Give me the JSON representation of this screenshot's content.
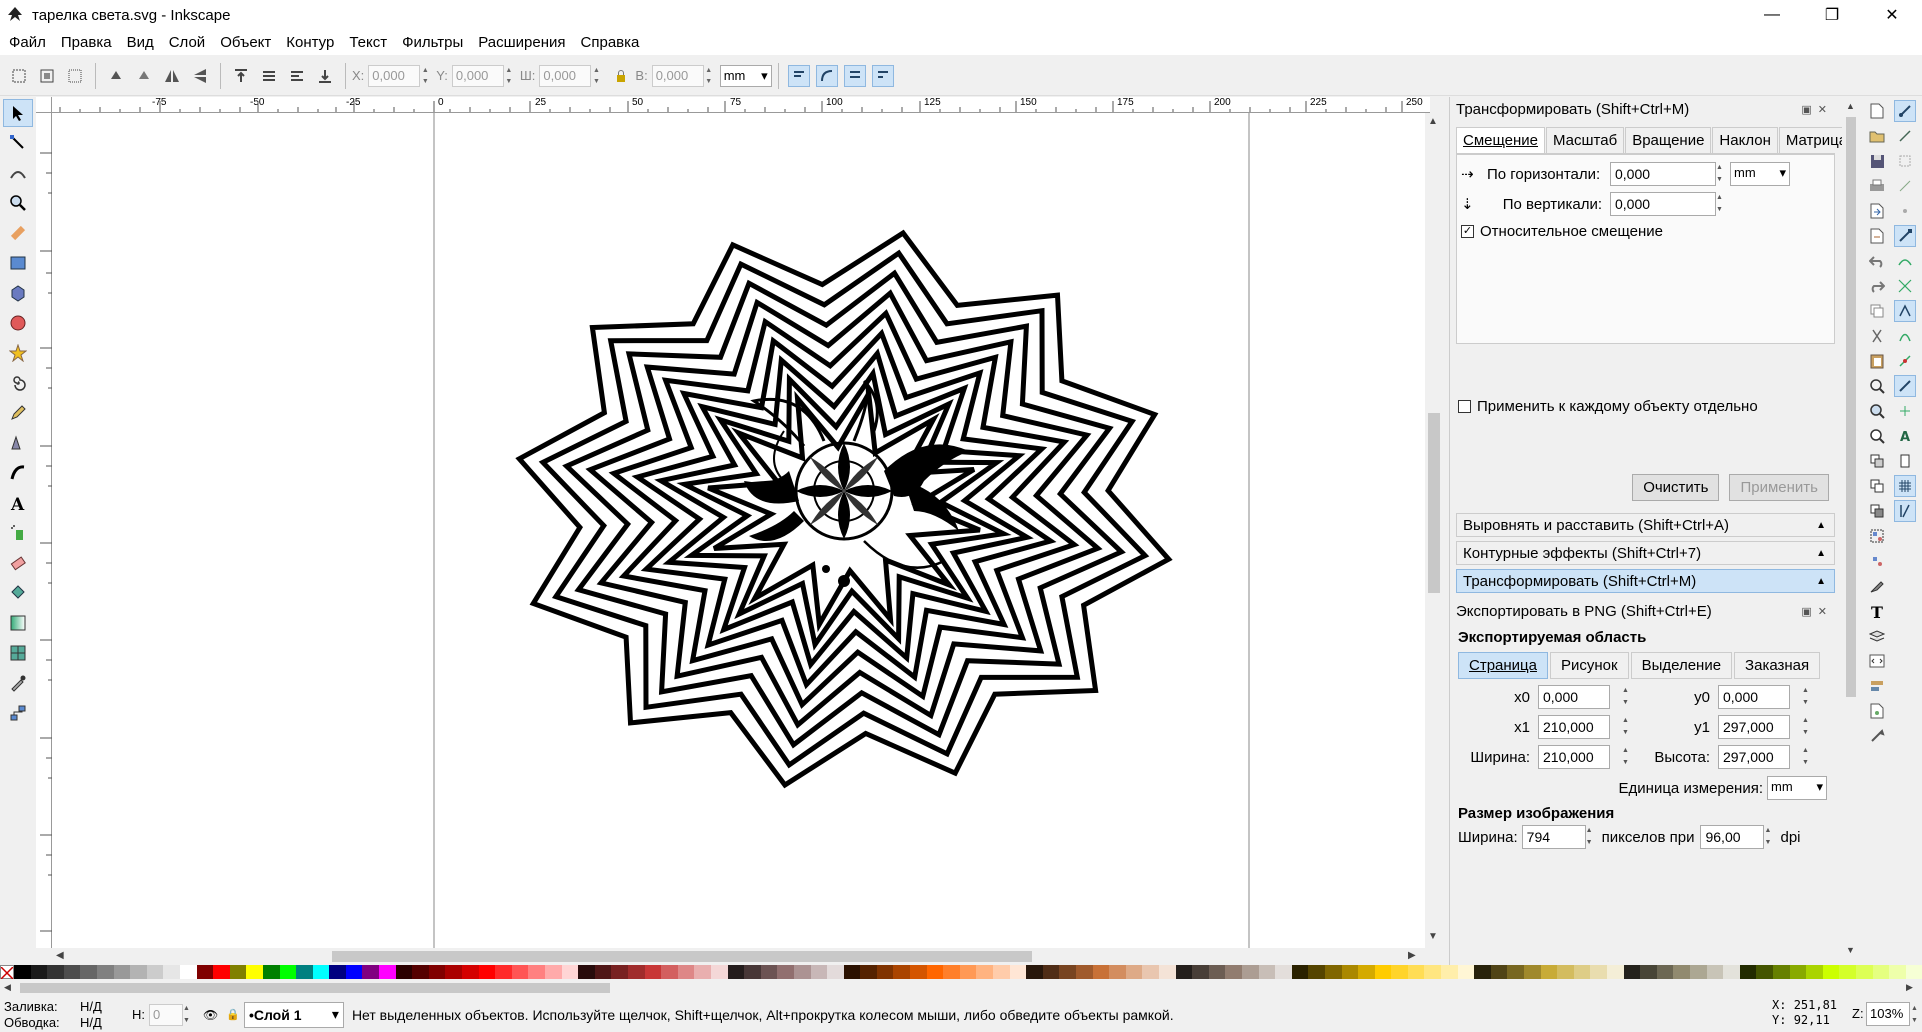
{
  "window": {
    "title": "тарелка света.svg - Inkscape",
    "minimize": "—",
    "maximize": "❐",
    "close": "✕"
  },
  "menu": [
    "Файл",
    "Правка",
    "Вид",
    "Слой",
    "Объект",
    "Контур",
    "Текст",
    "Фильтры",
    "Расширения",
    "Справка"
  ],
  "toolbar": {
    "x_label": "X:",
    "x_value": "0,000",
    "y_label": "Y:",
    "y_value": "0,000",
    "w_label": "Ш:",
    "w_value": "0,000",
    "h_label": "В:",
    "h_value": "0,000",
    "unit": "mm"
  },
  "ruler": {
    "ticks": [
      "-75",
      "-50",
      "-25",
      "0",
      "25",
      "50",
      "75",
      "100",
      "125",
      "150",
      "175",
      "200",
      "225",
      "250"
    ]
  },
  "transform": {
    "header": "Трансформировать (Shift+Ctrl+M)",
    "tabs": [
      "Смещение",
      "Масштаб",
      "Вращение",
      "Наклон",
      "Матрица"
    ],
    "horizontal_label": "По горизонтали:",
    "horizontal_value": "0,000",
    "vertical_label": "По вертикали:",
    "vertical_value": "0,000",
    "unit": "mm",
    "relative_label": "Относительное смещение",
    "apply_each_label": "Применить к каждому объекту отдельно",
    "clear_button": "Очистить",
    "apply_button": "Применить"
  },
  "collapsed_panels": [
    "Выровнять и расставить (Shift+Ctrl+A)",
    "Контурные эффекты (Shift+Ctrl+7)",
    "Трансформировать (Shift+Ctrl+M)"
  ],
  "export": {
    "header": "Экспортировать в PNG (Shift+Ctrl+E)",
    "area_title": "Экспортируемая область",
    "area_tabs": [
      "Страница",
      "Рисунок",
      "Выделение",
      "Заказная"
    ],
    "x0_label": "x0",
    "x0_value": "0,000",
    "y0_label": "y0",
    "y0_value": "0,000",
    "x1_label": "x1",
    "x1_value": "210,000",
    "y1_label": "y1",
    "y1_value": "297,000",
    "width_label": "Ширина:",
    "width_value": "210,000",
    "height_label": "Высота:",
    "height_value": "297,000",
    "units_label": "Единица измерения:",
    "units_value": "mm",
    "size_title": "Размер изображения",
    "img_width_label": "Ширина:",
    "img_width_value": "794",
    "pixels_at_label": "пикселов при",
    "dpi_value": "96,00",
    "dpi_label": "dpi"
  },
  "status": {
    "fill_label": "Заливка:",
    "fill_value": "Н/Д",
    "stroke_label": "Обводка:",
    "stroke_value": "Н/Д",
    "h_label": "Н:",
    "h_value": "0",
    "layer": "•Слой 1",
    "message": "Нет выделенных объектов. Используйте щелчок, Shift+щелчок, Alt+прокрутка колесом мыши, либо обведите объекты рамкой.",
    "x_label": "X:",
    "x_value": "251,81",
    "y_label": "Y:",
    "y_value": "92,11",
    "z_label": "Z:",
    "zoom_value": "103%"
  },
  "palette_colors": [
    "#000000",
    "#1a1a1a",
    "#333333",
    "#4d4d4d",
    "#666666",
    "#808080",
    "#999999",
    "#b3b3b3",
    "#cccccc",
    "#e6e6e6",
    "#ffffff",
    "#800000",
    "#ff0000",
    "#808000",
    "#ffff00",
    "#008000",
    "#00ff00",
    "#008080",
    "#00ffff",
    "#000080",
    "#0000ff",
    "#800080",
    "#ff00ff",
    "#2b0000",
    "#550000",
    "#800000",
    "#aa0000",
    "#d40000",
    "#ff0000",
    "#ff2a2a",
    "#ff5555",
    "#ff8080",
    "#ffaaaa",
    "#ffd5d5",
    "#280b0b",
    "#501616",
    "#782121",
    "#a02c2c",
    "#c83737",
    "#d35f5f",
    "#de8787",
    "#e9afaf",
    "#f4d7d7",
    "#241c1c",
    "#483737",
    "#6c5353",
    "#916f6f",
    "#ac9393",
    "#c8b7b7",
    "#e3dbdb",
    "#2b1100",
    "#552200",
    "#803300",
    "#aa4400",
    "#d45500",
    "#ff6600",
    "#ff7f2a",
    "#ff9955",
    "#ffb380",
    "#ffccaa",
    "#ffe6d5",
    "#28170b",
    "#502d16",
    "#784421",
    "#a05a2c",
    "#c87137",
    "#d38d5f",
    "#deaa87",
    "#e9c6af",
    "#f4e3d7",
    "#241f1c",
    "#483e37",
    "#6c5d53",
    "#917c6f",
    "#ac9d93",
    "#c8beb7",
    "#e3dedb",
    "#2b2200",
    "#554400",
    "#806600",
    "#aa8800",
    "#d4aa00",
    "#ffcc00",
    "#ffd42a",
    "#ffdd55",
    "#ffe680",
    "#ffeeaa",
    "#fff6d5",
    "#28220b",
    "#504416",
    "#786721",
    "#a0892c",
    "#c8ab37",
    "#d3bc5f",
    "#decd87",
    "#e9ddaf",
    "#f4eed7",
    "#24221c",
    "#484537",
    "#6c6753",
    "#918a6f",
    "#aca793",
    "#c8c4b7",
    "#e3e2db",
    "#222b00",
    "#445500",
    "#668000",
    "#88aa00",
    "#aad400",
    "#ccff00",
    "#d4ff2a",
    "#ddff55",
    "#e5ff80",
    "#eeffaa",
    "#f6ffd5"
  ]
}
